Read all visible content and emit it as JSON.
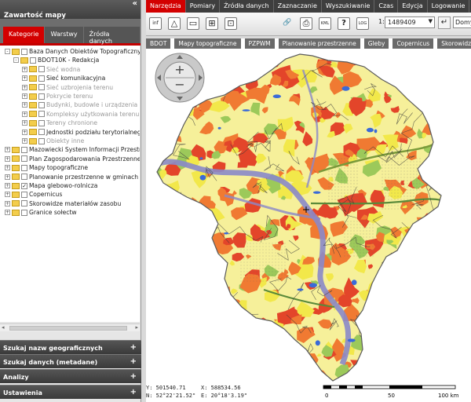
{
  "left_panel": {
    "title": "Zawartość mapy",
    "collapse_glyph": "«",
    "tabs": [
      {
        "label": "Kategorie",
        "active": true
      },
      {
        "label": "Warstwy",
        "active": false
      },
      {
        "label": "Źródła danych",
        "active": false
      }
    ],
    "tree": [
      {
        "label": "Baza Danych Obiektów Topograficznych",
        "level": 0,
        "expander": "-",
        "checked": false,
        "grey": false
      },
      {
        "label": "BDOT10K - Redakcja",
        "level": 1,
        "expander": "-",
        "checked": false,
        "grey": false
      },
      {
        "label": "Sieć wodna",
        "level": 2,
        "expander": "+",
        "checked": false,
        "grey": true
      },
      {
        "label": "Sieć komunikacyjna",
        "level": 2,
        "expander": "+",
        "checked": false,
        "grey": false
      },
      {
        "label": "Sieć uzbrojenia terenu",
        "level": 2,
        "expander": "+",
        "checked": false,
        "grey": true
      },
      {
        "label": "Pokrycie terenu",
        "level": 2,
        "expander": "+",
        "checked": false,
        "grey": true
      },
      {
        "label": "Budynki, budowle i urządzenia",
        "level": 2,
        "expander": "+",
        "checked": false,
        "grey": true
      },
      {
        "label": "Kompleksy użytkowania terenu",
        "level": 2,
        "expander": "+",
        "checked": false,
        "grey": true
      },
      {
        "label": "Tereny chronione",
        "level": 2,
        "expander": "+",
        "checked": false,
        "grey": true
      },
      {
        "label": "Jednostki podziału terytorialnego",
        "level": 2,
        "expander": "+",
        "checked": false,
        "grey": false
      },
      {
        "label": "Obiekty inne",
        "level": 2,
        "expander": "+",
        "checked": false,
        "grey": true
      },
      {
        "label": "Mazowiecki System Informacji Przestrzennej",
        "level": 0,
        "expander": "+",
        "checked": false,
        "grey": false
      },
      {
        "label": "Plan Zagospodarowania Przestrzennego",
        "level": 0,
        "expander": "+",
        "checked": false,
        "grey": false
      },
      {
        "label": "Mapy topograficzne",
        "level": 0,
        "expander": "+",
        "checked": false,
        "grey": false
      },
      {
        "label": "Planowanie przestrzenne w gminach",
        "level": 0,
        "expander": "+",
        "checked": false,
        "grey": false
      },
      {
        "label": "Mapa glebowo-rolnicza",
        "level": 0,
        "expander": "+",
        "checked": true,
        "grey": false
      },
      {
        "label": "Copernicus",
        "level": 0,
        "expander": "+",
        "checked": false,
        "grey": false
      },
      {
        "label": "Skorowidze materiałów zasobu",
        "level": 0,
        "expander": "+",
        "checked": false,
        "grey": false
      },
      {
        "label": "Granice sołectw",
        "level": 0,
        "expander": "+",
        "checked": false,
        "grey": false
      }
    ],
    "accordions": [
      {
        "label": "Szukaj nazw geograficznych"
      },
      {
        "label": "Szukaj danych (metadane)"
      },
      {
        "label": "Analizy"
      },
      {
        "label": "Ustawienia"
      }
    ]
  },
  "menu": [
    {
      "label": "Narzędzia",
      "active": true
    },
    {
      "label": "Pomiary",
      "active": false
    },
    {
      "label": "Źródła danych",
      "active": false
    },
    {
      "label": "Zaznaczanie",
      "active": false
    },
    {
      "label": "Wyszukiwanie",
      "active": false
    },
    {
      "label": "Czas",
      "active": false
    },
    {
      "label": "Edycja",
      "active": false
    },
    {
      "label": "Logowanie",
      "active": false
    }
  ],
  "toolbar": {
    "tools": [
      {
        "name": "info-icon",
        "glyph": "inf"
      },
      {
        "name": "measure-triangle-icon",
        "glyph": "△"
      },
      {
        "name": "copy-map-icon",
        "glyph": "▭"
      },
      {
        "name": "add-layer-icon",
        "glyph": "⊞"
      },
      {
        "name": "zoom-window-icon",
        "glyph": "⊡"
      },
      {
        "name": "link-icon",
        "glyph": "🔗"
      },
      {
        "name": "print-icon",
        "glyph": "⎙"
      },
      {
        "name": "kml-icon",
        "glyph": "KML"
      },
      {
        "name": "help-icon",
        "glyph": "?"
      },
      {
        "name": "log-icon",
        "glyph": "LOG"
      }
    ],
    "scale_prefix": "1:",
    "scale_value": "1489409",
    "enter_glyph": "↵",
    "extra_value": "Domyślna"
  },
  "layer_buttons": [
    {
      "label": "BDOT"
    },
    {
      "label": "Mapy topograficzne"
    },
    {
      "label": "PZPWM"
    },
    {
      "label": "Planowanie przestrzenne"
    },
    {
      "label": "Gleby"
    },
    {
      "label": "Copernicus"
    },
    {
      "label": "Skorowidze"
    }
  ],
  "nav": {
    "zoom_in": "+",
    "zoom_out": "−"
  },
  "coords": {
    "y": "Y:  501540.71",
    "x": "X:  588534.56",
    "n": "N: 52°22'21.52\"",
    "e": "E: 20°18'3.19\""
  },
  "scalebar": {
    "labels": [
      "0",
      "50",
      "100 km"
    ]
  },
  "colors": {
    "accent_red": "#d30000",
    "panel_dark": "#3e3e3e",
    "soil_orange": "#f07a32",
    "soil_red": "#e3452a",
    "soil_yellow": "#f2e84a",
    "soil_lightyellow": "#f6f09a",
    "soil_green": "#9cc95a",
    "river_purple": "#8a88c9",
    "water_blue": "#3a6ad8"
  }
}
